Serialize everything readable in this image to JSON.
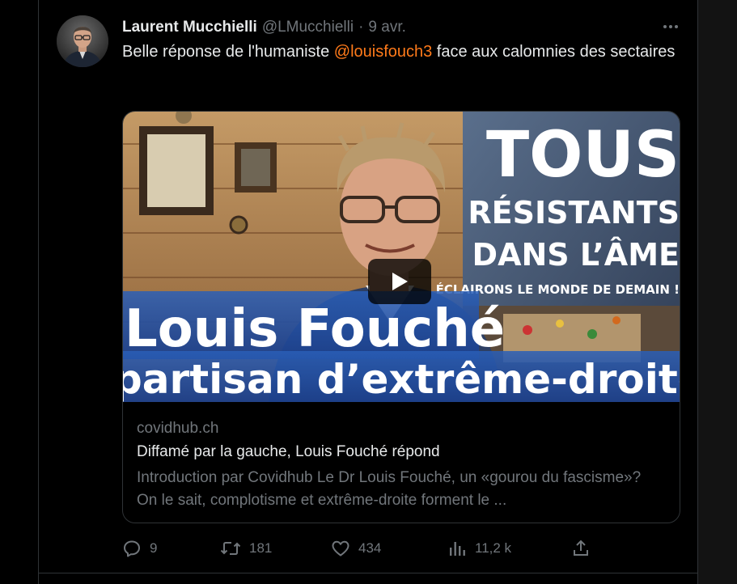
{
  "tweet": {
    "author_name": "Laurent Mucchielli",
    "handle": "@LMucchielli",
    "separator": "·",
    "time": "9 avr.",
    "text_before": "Belle réponse de l'humaniste ",
    "mention": "@louisfouch3",
    "text_after": " face aux calomnies des sectaires",
    "more_icon": "more-dots-icon"
  },
  "card": {
    "thumbnail": {
      "overlay_line1": "Louis Fouché",
      "overlay_line2": "partisan d’extrême-droite ???",
      "right_big": "TOUS",
      "right_mid1": "RÉSISTANTS",
      "right_mid2": "DANS L’ÂME",
      "right_small": "ÉCLAIRONS LE MONDE DE DEMAIN !"
    },
    "domain": "covidhub.ch",
    "title": "Diffamé par la gauche, Louis Fouché répond",
    "description": "Introduction par Covidhub Le Dr Louis Fouché, un «gourou du fascisme»? On le sait, complotisme et extrême-droite forment le ..."
  },
  "actions": {
    "reply_count": "9",
    "retweet_count": "181",
    "like_count": "434",
    "views_count": "11,2 k"
  },
  "colors": {
    "background": "#000000",
    "text": "#e7e9ea",
    "muted": "#71767b",
    "mention": "#ff7a1a",
    "border": "#2f3336"
  }
}
